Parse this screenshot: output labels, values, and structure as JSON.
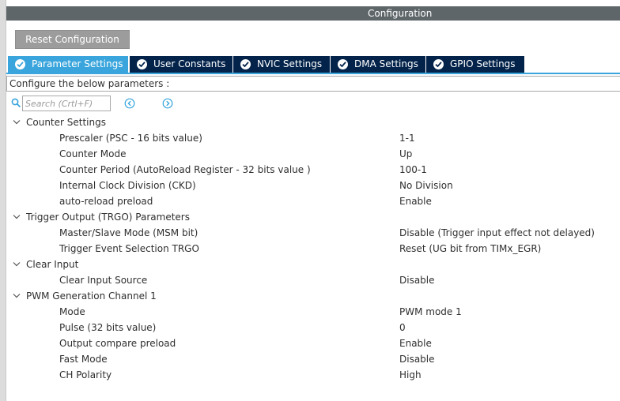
{
  "window": {
    "title": "Configuration"
  },
  "toolbar": {
    "reset_label": "Reset Configuration"
  },
  "tabs": [
    {
      "label": "Parameter Settings",
      "active": true
    },
    {
      "label": "User Constants",
      "active": false
    },
    {
      "label": "NVIC Settings",
      "active": false
    },
    {
      "label": "DMA Settings",
      "active": false
    },
    {
      "label": "GPIO Settings",
      "active": false
    }
  ],
  "hint": "Configure the below parameters :",
  "search": {
    "placeholder": "Search (Crtl+F)"
  },
  "colors": {
    "tab_active": "#39a5dc",
    "tab_inactive": "#03234b",
    "titlebar": "#5e6669",
    "button": "#9c9c9c"
  },
  "groups": [
    {
      "label": "Counter Settings",
      "params": [
        {
          "label": "Prescaler (PSC - 16 bits value)",
          "value": "1-1"
        },
        {
          "label": "Counter Mode",
          "value": "Up"
        },
        {
          "label": "Counter Period (AutoReload Register - 32 bits value )",
          "value": "100-1"
        },
        {
          "label": "Internal Clock Division (CKD)",
          "value": "No Division"
        },
        {
          "label": "auto-reload preload",
          "value": "Enable"
        }
      ]
    },
    {
      "label": "Trigger Output (TRGO) Parameters",
      "params": [
        {
          "label": "Master/Slave Mode (MSM bit)",
          "value": "Disable (Trigger input effect not delayed)"
        },
        {
          "label": "Trigger Event Selection TRGO",
          "value": "Reset (UG bit from TIMx_EGR)"
        }
      ]
    },
    {
      "label": "Clear Input",
      "params": [
        {
          "label": "Clear Input Source",
          "value": "Disable"
        }
      ]
    },
    {
      "label": "PWM Generation Channel 1",
      "params": [
        {
          "label": "Mode",
          "value": "PWM mode 1"
        },
        {
          "label": "Pulse (32 bits value)",
          "value": "0"
        },
        {
          "label": "Output compare preload",
          "value": "Enable"
        },
        {
          "label": "Fast Mode",
          "value": "Disable"
        },
        {
          "label": "CH Polarity",
          "value": "High"
        }
      ]
    }
  ]
}
